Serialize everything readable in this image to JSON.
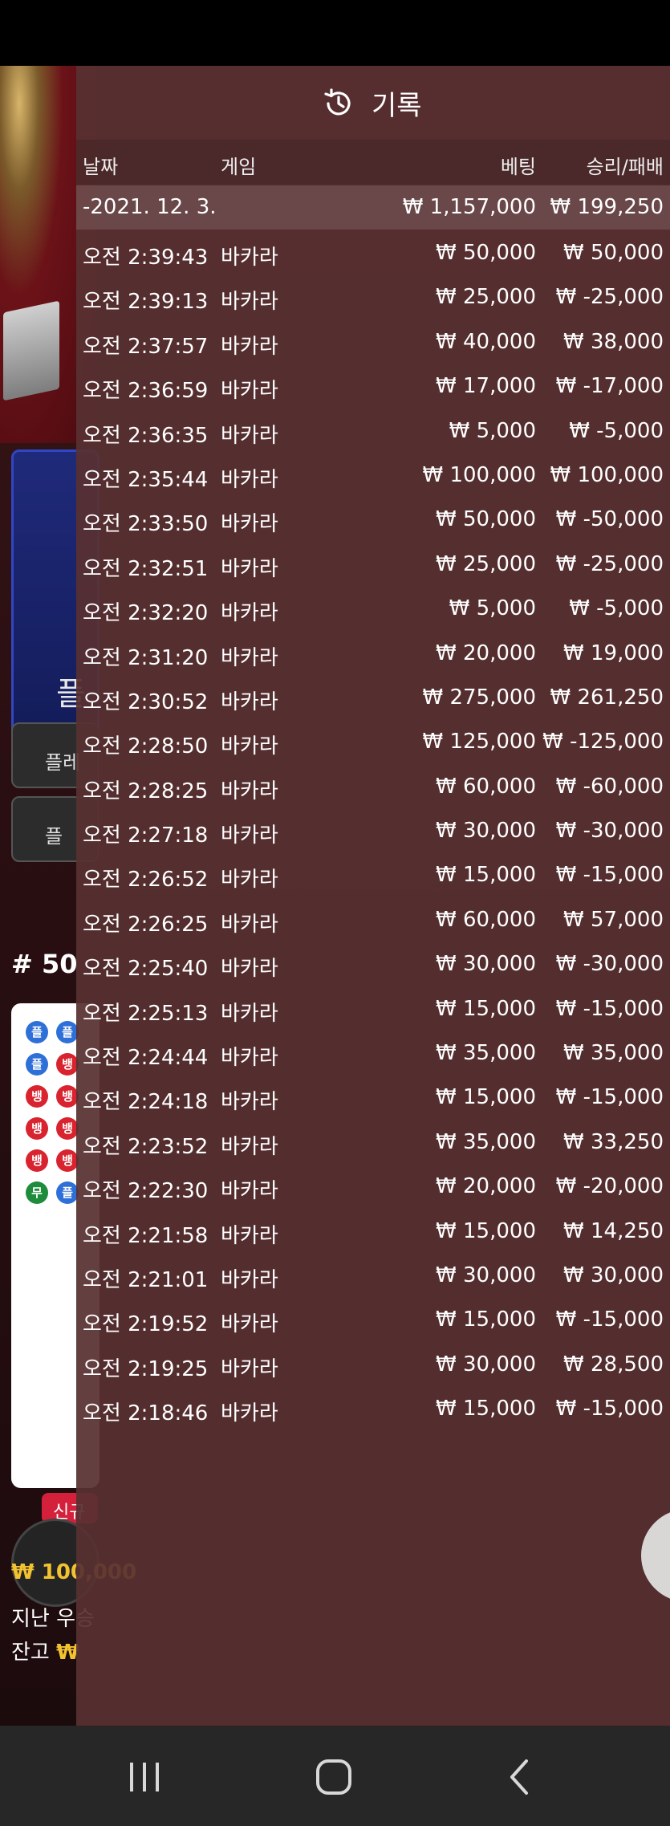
{
  "history": {
    "title": "기록",
    "columns": {
      "date": "날짜",
      "game": "게임",
      "bet": "베팅",
      "result": "승리/패배"
    },
    "date_group": {
      "date": "-2021. 12. 3.",
      "total_bet": "₩ 1,157,000",
      "total_result": "₩ 199,250"
    },
    "rows": [
      {
        "time": "오전 2:39:43",
        "game": "바카라",
        "bet": "₩ 50,000",
        "result": "₩ 50,000"
      },
      {
        "time": "오전 2:39:13",
        "game": "바카라",
        "bet": "₩ 25,000",
        "result": "₩ -25,000"
      },
      {
        "time": "오전 2:37:57",
        "game": "바카라",
        "bet": "₩ 40,000",
        "result": "₩ 38,000"
      },
      {
        "time": "오전 2:36:59",
        "game": "바카라",
        "bet": "₩ 17,000",
        "result": "₩ -17,000"
      },
      {
        "time": "오전 2:36:35",
        "game": "바카라",
        "bet": "₩ 5,000",
        "result": "₩ -5,000"
      },
      {
        "time": "오전 2:35:44",
        "game": "바카라",
        "bet": "₩ 100,000",
        "result": "₩ 100,000"
      },
      {
        "time": "오전 2:33:50",
        "game": "바카라",
        "bet": "₩ 50,000",
        "result": "₩ -50,000"
      },
      {
        "time": "오전 2:32:51",
        "game": "바카라",
        "bet": "₩ 25,000",
        "result": "₩ -25,000"
      },
      {
        "time": "오전 2:32:20",
        "game": "바카라",
        "bet": "₩ 5,000",
        "result": "₩ -5,000"
      },
      {
        "time": "오전 2:31:20",
        "game": "바카라",
        "bet": "₩ 20,000",
        "result": "₩ 19,000"
      },
      {
        "time": "오전 2:30:52",
        "game": "바카라",
        "bet": "₩ 275,000",
        "result": "₩ 261,250"
      },
      {
        "time": "오전 2:28:50",
        "game": "바카라",
        "bet": "₩ 125,000",
        "result": "₩ -125,000"
      },
      {
        "time": "오전 2:28:25",
        "game": "바카라",
        "bet": "₩ 60,000",
        "result": "₩ -60,000"
      },
      {
        "time": "오전 2:27:18",
        "game": "바카라",
        "bet": "₩ 30,000",
        "result": "₩ -30,000"
      },
      {
        "time": "오전 2:26:52",
        "game": "바카라",
        "bet": "₩ 15,000",
        "result": "₩ -15,000"
      },
      {
        "time": "오전 2:26:25",
        "game": "바카라",
        "bet": "₩ 60,000",
        "result": "₩ 57,000"
      },
      {
        "time": "오전 2:25:40",
        "game": "바카라",
        "bet": "₩ 30,000",
        "result": "₩ -30,000"
      },
      {
        "time": "오전 2:25:13",
        "game": "바카라",
        "bet": "₩ 15,000",
        "result": "₩ -15,000"
      },
      {
        "time": "오전 2:24:44",
        "game": "바카라",
        "bet": "₩ 35,000",
        "result": "₩ 35,000"
      },
      {
        "time": "오전 2:24:18",
        "game": "바카라",
        "bet": "₩ 15,000",
        "result": "₩ -15,000"
      },
      {
        "time": "오전 2:23:52",
        "game": "바카라",
        "bet": "₩ 35,000",
        "result": "₩ 33,250"
      },
      {
        "time": "오전 2:22:30",
        "game": "바카라",
        "bet": "₩ 20,000",
        "result": "₩ -20,000"
      },
      {
        "time": "오전 2:21:58",
        "game": "바카라",
        "bet": "₩ 15,000",
        "result": "₩ 14,250"
      },
      {
        "time": "오전 2:21:01",
        "game": "바카라",
        "bet": "₩ 30,000",
        "result": "₩ 30,000"
      },
      {
        "time": "오전 2:19:52",
        "game": "바카라",
        "bet": "₩ 15,000",
        "result": "₩ -15,000"
      },
      {
        "time": "오전 2:19:25",
        "game": "바카라",
        "bet": "₩ 30,000",
        "result": "₩ 28,500"
      },
      {
        "time": "오전 2:18:46",
        "game": "바카라",
        "bet": "₩ 15,000",
        "result": "₩ -15,000"
      }
    ]
  },
  "background": {
    "player_label": "플",
    "btn1_label": "플레",
    "btn2_label": "플",
    "round_label": "# 50",
    "new_badge": "신규",
    "balance_line1_amount": "₩ 100,000",
    "balance_line2_label": "지난 우승",
    "balance_line3_label": "잔고",
    "balance_line3_amount": "₩"
  },
  "colors": {
    "overlay_bg": "#58303299",
    "player_blue": "#2e6fd8",
    "banker_red": "#d9232e",
    "tie_green": "#1e8c3a",
    "gold": "#f2c230"
  },
  "icons": {
    "header": "history-icon",
    "close": "close-icon"
  }
}
